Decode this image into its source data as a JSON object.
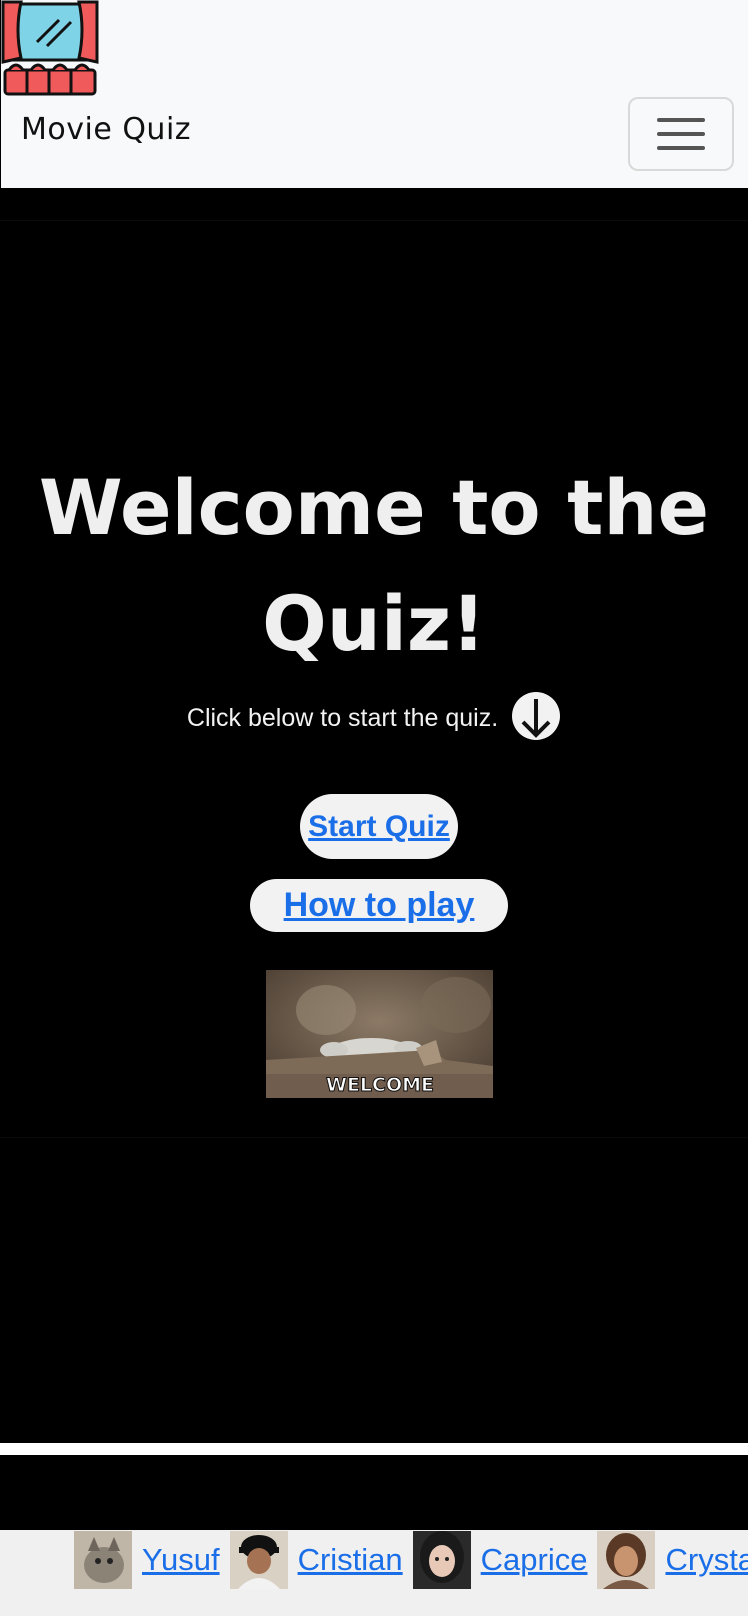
{
  "navbar": {
    "brand": "Movie Quiz",
    "logo_icon": "theater-logo-icon",
    "toggler_icon": "hamburger-menu-icon"
  },
  "hero": {
    "title_line1": "Welcome to the",
    "title_line2": "Quiz!",
    "subtitle": "Click below to start the quiz.",
    "subtitle_icon": "arrow-down-circle-icon",
    "start_button": "Start Quiz",
    "howto_button": "How to play",
    "welcome_image_text": "WELCOME"
  },
  "footer": {
    "members": [
      {
        "name": "Yusuf"
      },
      {
        "name": "Cristian"
      },
      {
        "name": "Caprice"
      },
      {
        "name": "Crystal"
      }
    ]
  },
  "colors": {
    "link": "#1a6ee8",
    "navbar_bg": "#f8f9fa",
    "page_bg": "#000000",
    "pill_bg": "#f2f2f2"
  }
}
